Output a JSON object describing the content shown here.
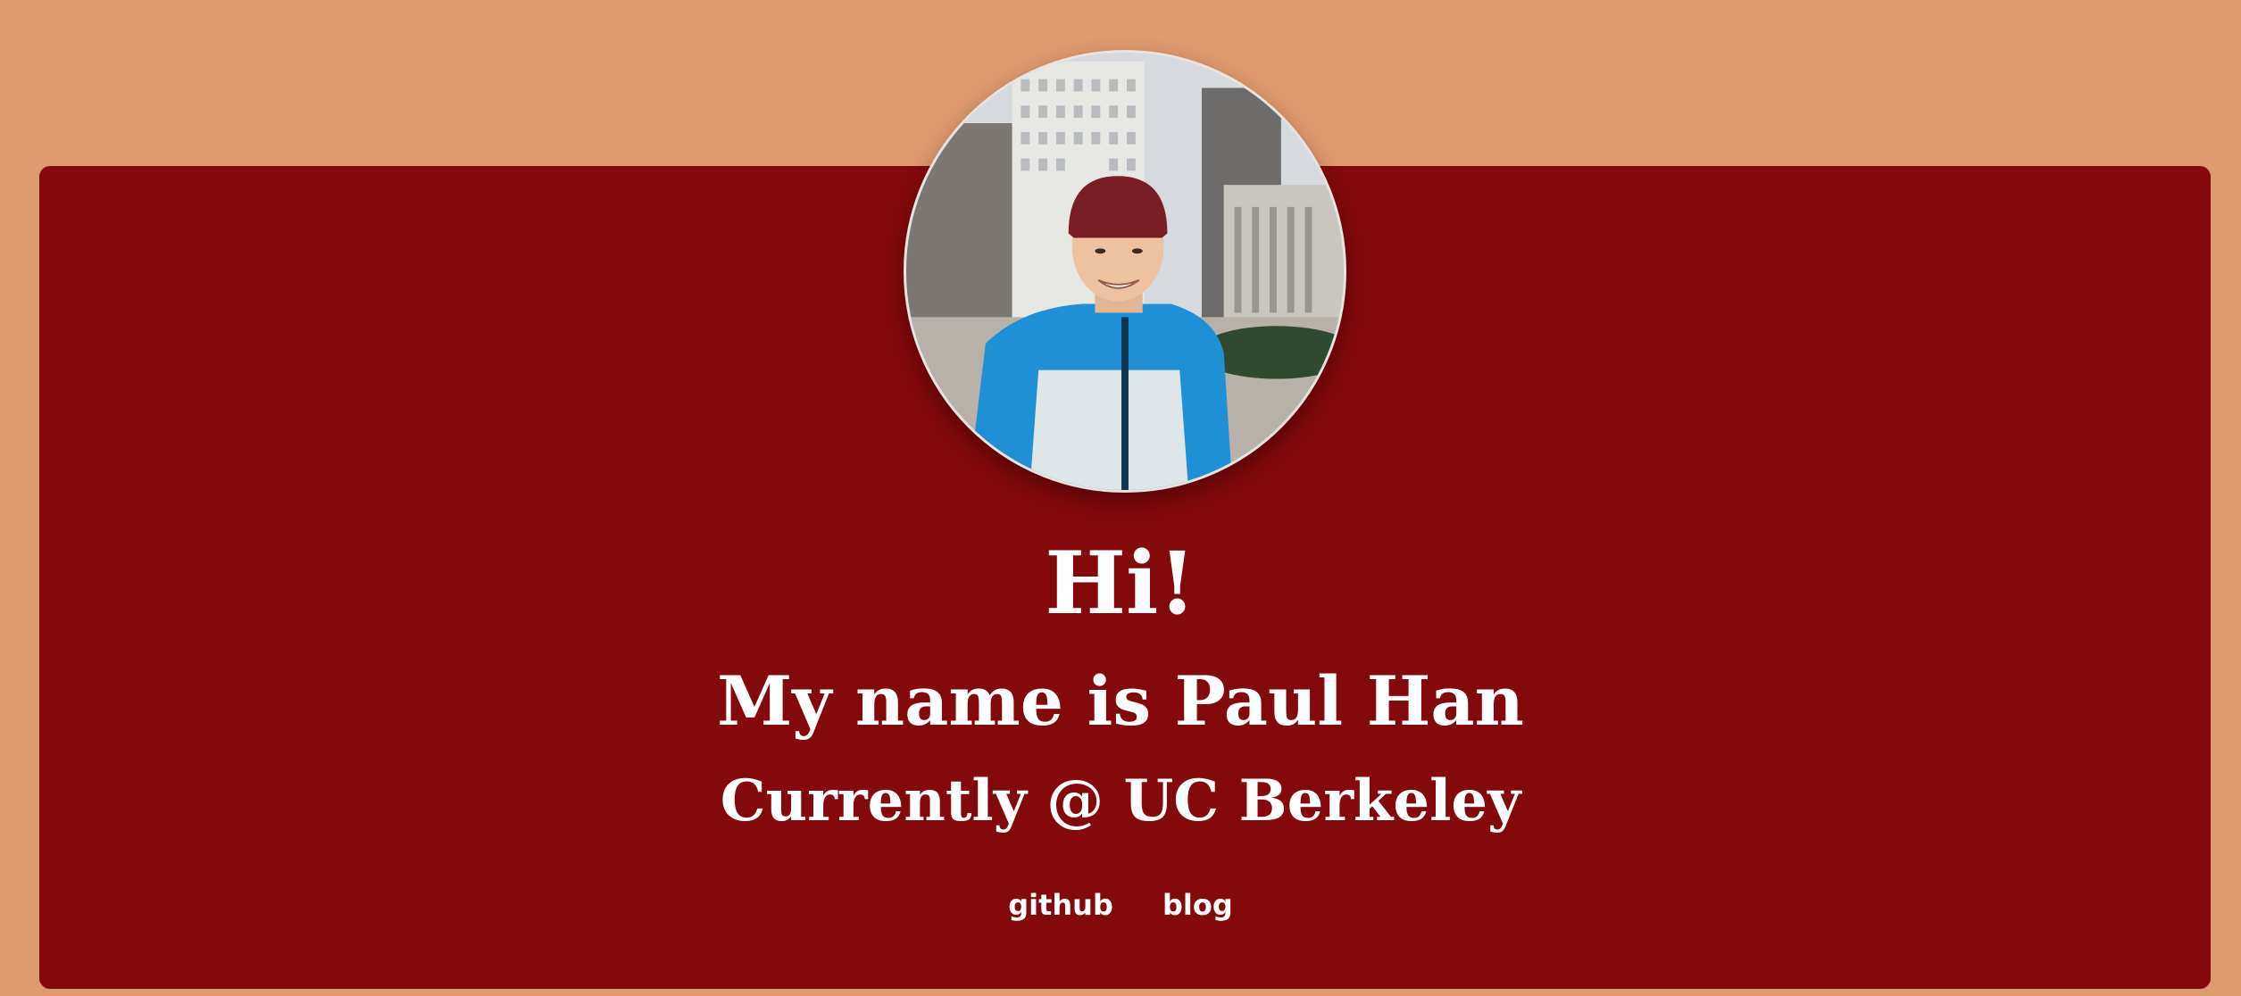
{
  "header": {
    "greeting": "Hi!",
    "name_line": "My name is Paul Han",
    "location_line": "Currently @ UC Berkeley"
  },
  "nav": {
    "links": [
      {
        "label": "github"
      },
      {
        "label": "blog"
      }
    ]
  },
  "colors": {
    "page_background": "#df9a6f",
    "card_background": "#84090c",
    "text": "#ffffff"
  }
}
